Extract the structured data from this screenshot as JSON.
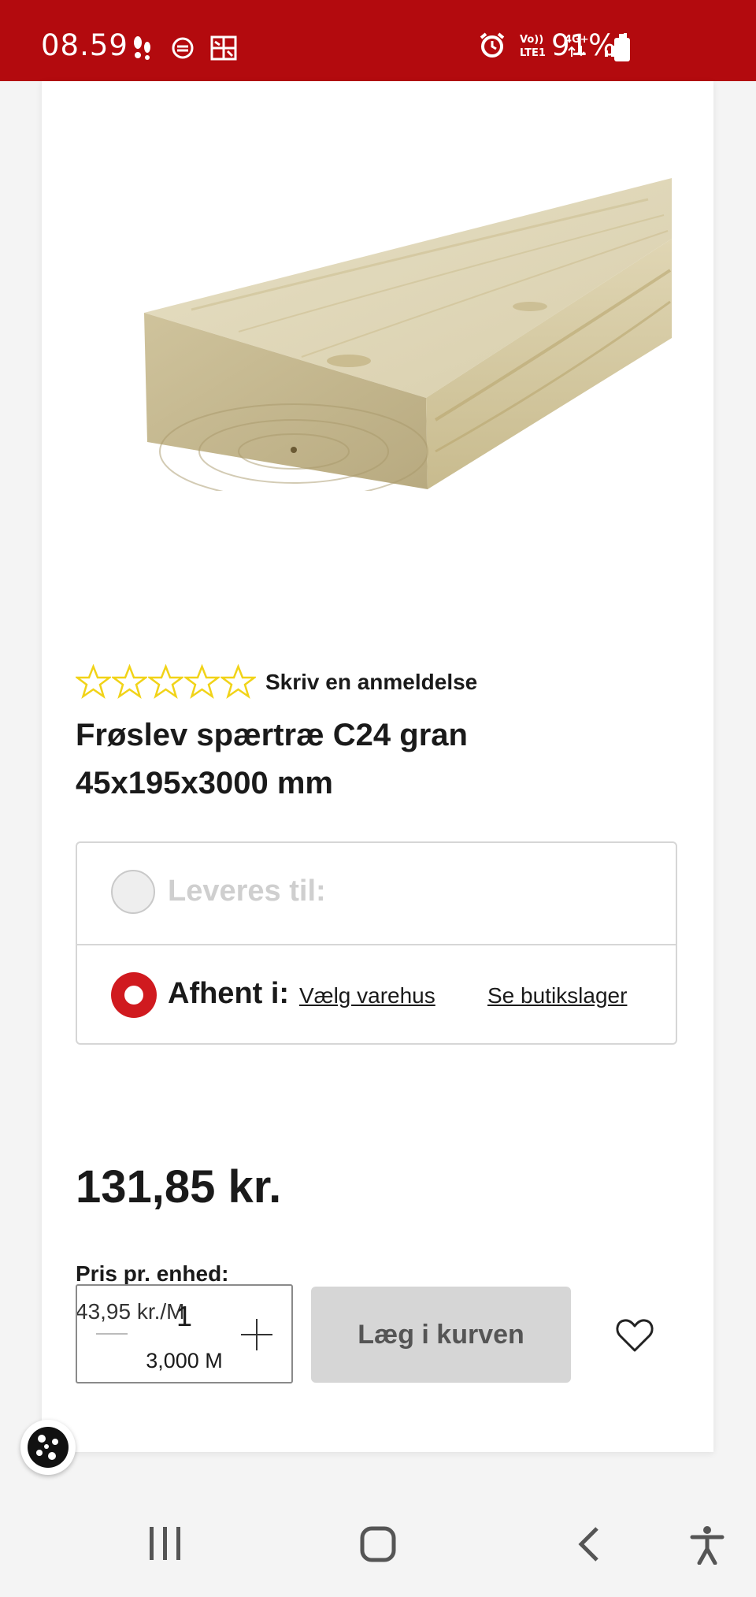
{
  "status_bar": {
    "time": "08.59",
    "network": "4G+",
    "volte": "Vo)) LTE1",
    "battery": "91%"
  },
  "product": {
    "image_alt": "spruce rafter board",
    "review_link": "Skriv en anmeldelse",
    "rating_stars": 0,
    "title_line1": "Frøslev spærtræ C24 gran",
    "title_line2": "45x195x3000 mm",
    "price": "131,85 kr.",
    "unit_price_label": "Pris pr. enhed:",
    "unit_price": "43,95 kr./M"
  },
  "delivery": {
    "deliver_label": "Leveres til:",
    "pickup_label": "Afhent i:",
    "choose_store": "Vælg varehus",
    "see_stock": "Se butikslager"
  },
  "purchase": {
    "quantity": "1",
    "length": "3,000 M",
    "add_to_cart": "Læg i kurven"
  },
  "colors": {
    "brand_red": "#b30a0e",
    "radio_red": "#d01a1f",
    "star_yellow": "#f1d318"
  }
}
